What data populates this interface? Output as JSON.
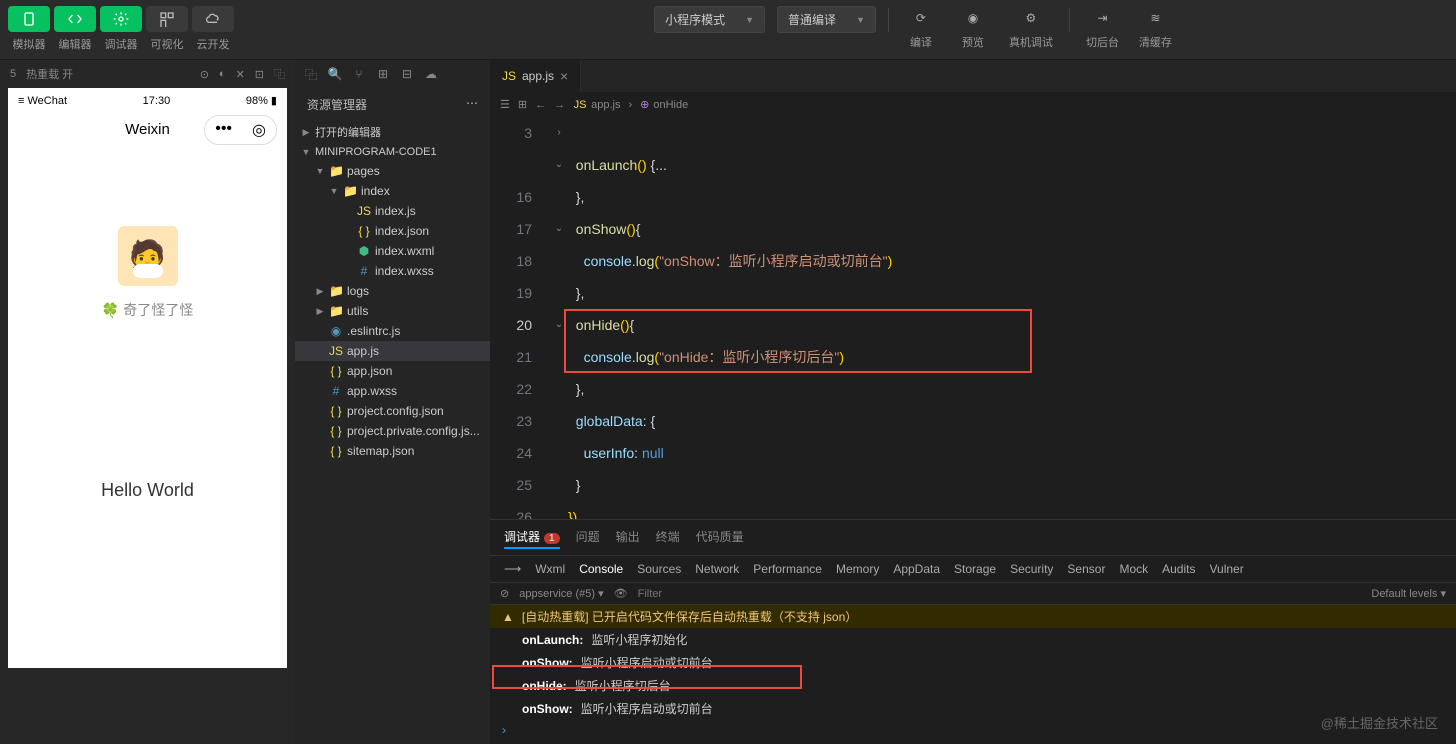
{
  "topbar": {
    "buttons": [
      "模拟器",
      "编辑器",
      "调试器",
      "可视化",
      "云开发"
    ],
    "mode_dropdown": "小程序模式",
    "compile_dropdown": "普通编译",
    "actions": [
      "编译",
      "预览",
      "真机调试",
      "切后台",
      "清缓存"
    ]
  },
  "sim_toolbar": {
    "hot_reload": "热重载 开",
    "page_indicator": "5"
  },
  "simulator": {
    "carrier": "WeChat",
    "signal": "≡",
    "time": "17:30",
    "battery_pct": "98%",
    "title": "Weixin",
    "nickname": "奇了怪了怪",
    "hello": "Hello World"
  },
  "explorer": {
    "title": "资源管理器",
    "section_open": "打开的编辑器",
    "project": "MINIPROGRAM-CODE1",
    "tree": [
      {
        "name": "pages",
        "type": "folder",
        "depth": 1,
        "open": true
      },
      {
        "name": "index",
        "type": "folder",
        "depth": 2,
        "open": true
      },
      {
        "name": "index.js",
        "type": "js",
        "depth": 3
      },
      {
        "name": "index.json",
        "type": "json",
        "depth": 3
      },
      {
        "name": "index.wxml",
        "type": "wxml",
        "depth": 3
      },
      {
        "name": "index.wxss",
        "type": "wxss",
        "depth": 3
      },
      {
        "name": "logs",
        "type": "folder",
        "depth": 1,
        "open": false
      },
      {
        "name": "utils",
        "type": "folder",
        "depth": 1,
        "open": false
      },
      {
        "name": ".eslintrc.js",
        "type": "config",
        "depth": 1
      },
      {
        "name": "app.js",
        "type": "js",
        "depth": 1,
        "active": true
      },
      {
        "name": "app.json",
        "type": "json",
        "depth": 1
      },
      {
        "name": "app.wxss",
        "type": "wxss",
        "depth": 1
      },
      {
        "name": "project.config.json",
        "type": "json",
        "depth": 1
      },
      {
        "name": "project.private.config.js...",
        "type": "json",
        "depth": 1
      },
      {
        "name": "sitemap.json",
        "type": "json",
        "depth": 1
      }
    ]
  },
  "editor": {
    "tab_file": "app.js",
    "breadcrumb_file": "app.js",
    "breadcrumb_symbol": "onHide",
    "lines": [
      {
        "n": 3,
        "html": ""
      },
      {
        "n": "",
        "html": "  <span class='kw'>onLaunch</span><span class='paren'>()</span> <span class='punc'>{</span><span class='punc'>...</span>"
      },
      {
        "n": 16,
        "html": "  <span class='punc'>},</span>"
      },
      {
        "n": 17,
        "html": "  <span class='kw'>onShow</span><span class='paren'>()</span><span class='punc'>{</span>"
      },
      {
        "n": 18,
        "html": "    <span class='prop'>console</span><span class='punc'>.</span><span class='kw'>log</span><span class='paren'>(</span><span class='str'>\"onShow：监听小程序启动或切前台\"</span><span class='paren'>)</span>"
      },
      {
        "n": 19,
        "html": "  <span class='punc'>},</span>"
      },
      {
        "n": 20,
        "html": "  <span class='kw'>onHide</span><span class='paren'>()</span><span class='punc'>{</span>",
        "current": true
      },
      {
        "n": 21,
        "html": "    <span class='prop'>console</span><span class='punc'>.</span><span class='kw'>log</span><span class='paren'>(</span><span class='str'>\"onHide：监听小程序切后台\"</span><span class='paren'>)</span>"
      },
      {
        "n": 22,
        "html": "  <span class='punc'>},</span>"
      },
      {
        "n": 23,
        "html": "  <span class='prop'>globalData</span><span class='punc'>: {</span>"
      },
      {
        "n": 24,
        "html": "    <span class='prop'>userInfo</span><span class='punc'>:</span> <span class='null'>null</span>"
      },
      {
        "n": 25,
        "html": "  <span class='punc'>}</span>"
      },
      {
        "n": 26,
        "html": "<span class='paren'>})</span>"
      }
    ]
  },
  "panel": {
    "tabs": [
      "调试器",
      "问题",
      "输出",
      "终端",
      "代码质量"
    ],
    "debugger_badge": "1",
    "devtools": [
      "Wxml",
      "Console",
      "Sources",
      "Network",
      "Performance",
      "Memory",
      "AppData",
      "Storage",
      "Security",
      "Sensor",
      "Mock",
      "Audits",
      "Vulner"
    ],
    "context": "appservice (#5)",
    "filter_placeholder": "Filter",
    "levels": "Default levels ▾",
    "console": [
      {
        "type": "warn",
        "text": "[自动热重载] 已开启代码文件保存后自动热重载（不支持 json）"
      },
      {
        "type": "log",
        "label": "onLaunch:",
        "text": "监听小程序初始化"
      },
      {
        "type": "log",
        "label": "onShow:",
        "text": "监听小程序启动或切前台"
      },
      {
        "type": "log",
        "label": "onHide:",
        "text": "监听小程序切后台",
        "boxed": true
      },
      {
        "type": "log",
        "label": "onShow:",
        "text": "监听小程序启动或切前台"
      }
    ]
  },
  "watermark": "@稀土掘金技术社区"
}
